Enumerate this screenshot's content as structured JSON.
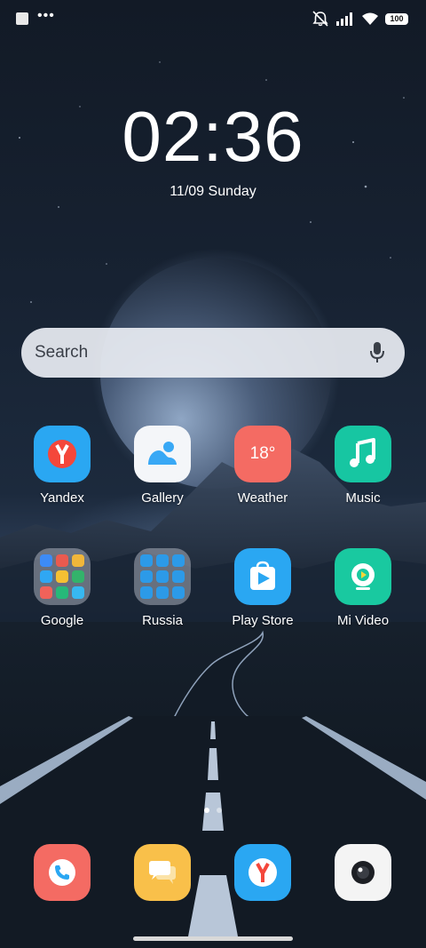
{
  "status_bar": {
    "battery": "100",
    "icons": [
      "notification-square-icon",
      "more-notifications-icon",
      "silent-bell-icon",
      "cellular-signal-icon",
      "wifi-icon",
      "battery-icon"
    ]
  },
  "clock": {
    "time": "02:36",
    "date": "11/09 Sunday"
  },
  "search": {
    "placeholder": "Search",
    "icon": "microphone-icon"
  },
  "apps": [
    {
      "label": "Yandex",
      "icon": "yandex-icon",
      "color": "#2aa7f2"
    },
    {
      "label": "Gallery",
      "icon": "gallery-icon",
      "color": "#f4f6f9"
    },
    {
      "label": "Weather",
      "icon": "weather-icon",
      "icon_text": "18°",
      "color": "#f46b63"
    },
    {
      "label": "Music",
      "icon": "music-icon",
      "color": "#17c6a2"
    },
    {
      "label": "Google",
      "icon": "google-folder-icon"
    },
    {
      "label": "Russia",
      "icon": "russia-folder-icon"
    },
    {
      "label": "Play Store",
      "icon": "play-store-icon",
      "color": "#2aa7f2"
    },
    {
      "label": "Mi Video",
      "icon": "mi-video-icon",
      "color": "#19c9a0"
    }
  ],
  "dock": [
    {
      "icon": "phone-icon",
      "color": "#f46b63"
    },
    {
      "icon": "messages-icon",
      "color": "#f9c04a"
    },
    {
      "icon": "yandex-browser-icon",
      "color": "#2aa7f2"
    },
    {
      "icon": "camera-icon",
      "color": "#f4f4f4"
    }
  ],
  "page_indicator": {
    "pages": 2,
    "current": 1
  }
}
